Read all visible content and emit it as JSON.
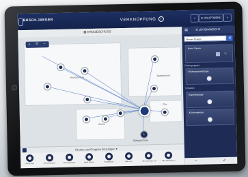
{
  "header": {
    "brand": "BUSCH-JAEGER",
    "title": "VERKNÜPFUNG",
    "help": "?",
    "nav_back": "<",
    "nav_home": "★ HAUPTMENÜ",
    "nav_next": ">"
  },
  "toolbar": {
    "room": "ERDGESCHOSS"
  },
  "map": {
    "rooms": [
      "Wohnzimmer",
      "Badezimmer",
      "Flur",
      "Küche"
    ],
    "hub_label": "Obergeschoss",
    "hub_number": "1",
    "controls": [
      "+",
      "⤧",
      "−"
    ]
  },
  "tab_bar": {
    "label": "Szenen und Gruppen hinzufügen"
  },
  "dock": {
    "items": [
      "Lichtgruppe",
      "Jalousiegruppe",
      "Dimmergruppe",
      "Neue Szene",
      "Panikszene",
      "Alles aus",
      "Alle Jalousien auf",
      "Alle Jalousien zu"
    ]
  },
  "panel": {
    "list_view": "LISTENANSICHT",
    "search_value": "Neue Szene",
    "search_clear": "✕",
    "new_scene": "Neue Szene",
    "section_dimmer": "Dimmgruppen",
    "dimmer_card": "Wohnzimmerlampe",
    "section_switch": "Schalten",
    "switch_cards": [
      "Küchenlampe",
      "Küchenlampe"
    ],
    "back": "←",
    "confirm": "✓"
  },
  "colors": {
    "header": "#14234b",
    "panel": "#1e2c55",
    "accent": "#3a6ad4"
  }
}
